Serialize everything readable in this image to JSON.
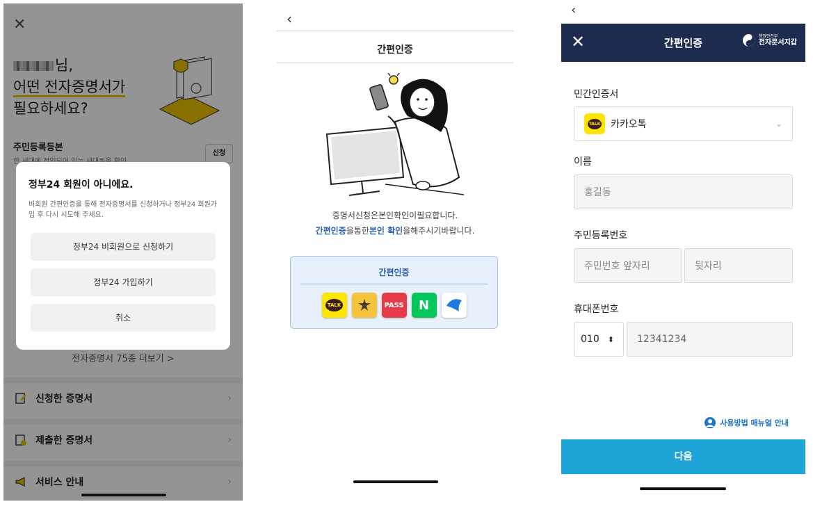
{
  "p1": {
    "greeting_suffix": "님,",
    "greeting_line2": "어떤 전자증명서가",
    "greeting_line3": "필요하세요?",
    "cert_title": "주민등록등본",
    "cert_sub": "한 세대에 전입되어 있는 세대원을 확인",
    "apply_label": "신청",
    "dialog": {
      "title": "정부24 회원이 아니에요.",
      "body": "비회원 간편인증을 통해 전자증명서를 신청하거나 정부24 회원가입 후 다시 시도해 주세요.",
      "btn_nonmember": "정부24 비회원으로 신청하기",
      "btn_join": "정부24 가입하기",
      "btn_cancel": "취소"
    },
    "more_link": "전자증명서 75종 더보기 >",
    "menu": {
      "applied": "신청한 증명서",
      "submitted": "제출한 증명서",
      "service": "서비스 안내"
    }
  },
  "p2": {
    "title": "간편인증",
    "msg1": "증명서신청은본인확인이필요합니다.",
    "msg2_a": "간편인증",
    "msg2_b": "을통한",
    "msg2_c": "본인 확인",
    "msg2_d": "을해주시기바랍니다.",
    "auth_title": "간편인증",
    "icons": {
      "talk": "TALK",
      "pass": "PASS",
      "naver": "N"
    }
  },
  "p3": {
    "header_title": "간편인증",
    "logo_line1": "행정안전부",
    "logo_line2": "전자문서지갑",
    "private_cert_label": "민간인증서",
    "private_cert_value": "카카오톡",
    "name_label": "이름",
    "name_placeholder": "홍길동",
    "rrn_label": "주민등록번호",
    "rrn_front_placeholder": "주민번호 앞자리",
    "rrn_back_placeholder": "뒷자리",
    "phone_label": "휴대폰번호",
    "phone_prefix": "010",
    "phone_number": "12341234",
    "manual_link": "사용방법 매뉴얼 안내",
    "next_button": "다음"
  },
  "colors": {
    "accent_yellow": "#e8c200",
    "navy": "#1d2c4e",
    "next_blue": "#1ea4d6",
    "link_blue": "#2a5fb0"
  }
}
